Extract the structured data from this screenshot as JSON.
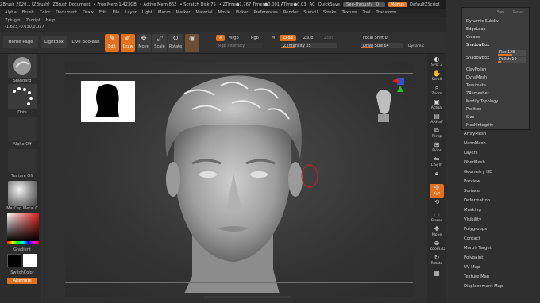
{
  "titlebar": {
    "app": "ZBrush 2020.1 [ZBrush]",
    "doc": "ZBrush Document",
    "free_mem": "• Free Mem 1.423GB",
    "active_mem": "• Active Mem 862",
    "scratch": "• Scratch Disk 75",
    "ztime": "• ZTime●1.767 Timer●0.001 ATime●0.03",
    "ac": "AC",
    "quicksave": "QuickSave",
    "seethrough": "See-through",
    "seethrough_value": "0",
    "menus": "Menus",
    "script": "DefaultZScript"
  },
  "menubar": [
    "Alpha",
    "Brush",
    "Color",
    "Document",
    "Draw",
    "Edit",
    "File",
    "Layer",
    "Light",
    "Macro",
    "Marker",
    "Material",
    "Movie",
    "Picker",
    "Preferences",
    "Render",
    "Stencil",
    "Stroke",
    "Texture",
    "Tool",
    "Transform"
  ],
  "menubar2": [
    "Zplugin",
    "Zscript",
    "Help"
  ],
  "coords": "-1.623,-0.030,0.057",
  "toolbar": {
    "home": "Home Page",
    "lightbox": "LightBox",
    "live_boolean": "Live Boolean",
    "tools": [
      {
        "label": "Edit",
        "icon": "edit-icon"
      },
      {
        "label": "Draw",
        "icon": "draw-icon"
      },
      {
        "label": "Move",
        "icon": "move-icon"
      },
      {
        "label": "Scale",
        "icon": "scale-icon"
      },
      {
        "label": "Rotate",
        "icon": "rotate-icon"
      }
    ],
    "a_chip": "A",
    "mrgb": "Mrgb",
    "rgb": "Rgb",
    "m": "M",
    "zadd": "Zadd",
    "zsub": "Zsub",
    "zcut": "Zcut",
    "rgb_intensity": "Rgb Intensity",
    "z_intensity": "Z Intensity 25",
    "focal_shift": "Focal Shift 0",
    "draw_size": "Draw Size 64",
    "dynamic": "Dynamic",
    "z_intensity_level": 0.25,
    "draw_size_level": 0.3
  },
  "leftshelf": {
    "standard": "Standard",
    "dots": "Dots",
    "alpha_off": "Alpha Off",
    "texture_off": "Texture Off",
    "matcap": "MatCap Metal C",
    "gradient": "Gradient",
    "switchcolor": "SwitchColor",
    "alternate": "Alternate"
  },
  "rshelf": [
    {
      "label": "SPix 3",
      "icon": "spix-icon"
    },
    {
      "label": "Scroll",
      "icon": "scroll-icon"
    },
    {
      "label": "Zoom",
      "icon": "zoom-icon"
    },
    {
      "label": "Actual",
      "icon": "actual-icon"
    },
    {
      "label": "AAHalf",
      "icon": "aahalf-icon"
    },
    {
      "label": "Persp",
      "icon": "persp-icon"
    },
    {
      "label": "Floor",
      "icon": "floor-icon"
    },
    {
      "label": "L.Sym",
      "icon": "lsym-icon"
    },
    {
      "label": "",
      "icon": "lock-icon"
    },
    {
      "label": "Xyz",
      "icon": "xyz-icon"
    },
    {
      "label": "",
      "icon": "rotate-axis-icon"
    },
    {
      "label": "Frame",
      "icon": "frame-icon"
    },
    {
      "label": "Move",
      "icon": "move-view-icon"
    },
    {
      "label": "Zoom3D",
      "icon": "zoom3d-icon"
    },
    {
      "label": "Rotate",
      "icon": "rotate-view-icon"
    },
    {
      "label": "",
      "icon": "polyf-icon"
    }
  ],
  "popup": {
    "top": [
      "Sav",
      "Reset"
    ],
    "items": [
      "Dynamic Subdiv",
      "EdgeLoop",
      "Crease",
      "ShadowBox",
      "ShadowBox",
      "ClayPolish",
      "DynaMesh",
      "Tessimate",
      "ZRemesher",
      "Modify Topology",
      "Position",
      "Size",
      "MeshIntegrity"
    ],
    "res_label": "Res 128",
    "polish_label": "Polish 10",
    "res_level": 0.5,
    "polish_level": 0.1
  },
  "rpanel_sections": [
    "ArrayMesh",
    "NanoMesh",
    "Layers",
    "FiberMesh",
    "Geometry HD",
    "Preview",
    "Surface",
    "Deformation",
    "Masking",
    "Visibility",
    "Polygroups",
    "Contact",
    "Morph Target",
    "Polypaint",
    "UV Map",
    "Texture Map",
    "Displacement Map"
  ],
  "colors": {
    "accent": "#e2701c",
    "background": "#2a2a2a",
    "panel": "#2f2f2f"
  }
}
